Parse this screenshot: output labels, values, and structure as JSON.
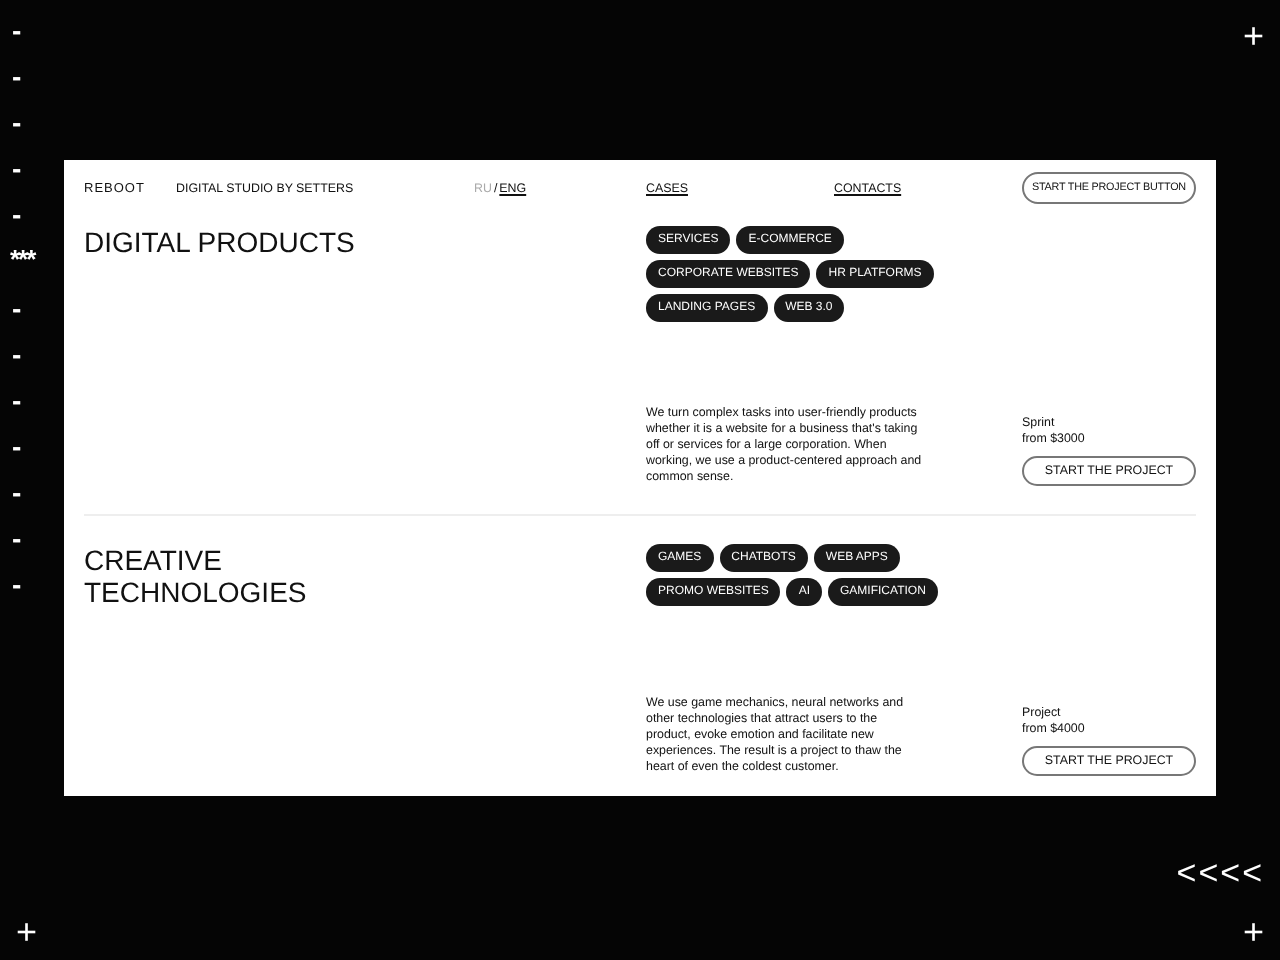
{
  "side_marks": [
    "-",
    "-",
    "-",
    "-",
    "-",
    "***",
    "-",
    "-",
    "-",
    "-",
    "-",
    "-",
    "-"
  ],
  "corner_marks": {
    "top_right": "+",
    "bottom_left": "+",
    "bottom_right": "+",
    "back_arrows": "<<<<"
  },
  "header": {
    "logo": "REBOOT",
    "tagline": "DIGITAL STUDIO BY SETTERS",
    "languages": [
      {
        "label": "RU",
        "selected": false
      },
      {
        "label": "ENG",
        "selected": true
      }
    ],
    "language_separator": "/",
    "nav": [
      "CASES",
      "CONTACTS"
    ],
    "cta": "START THE PROJECT BUTTON"
  },
  "sections": [
    {
      "title": "DIGITAL PRODUCTS",
      "tags": [
        "SERVICES",
        "E-COMMERCE",
        "CORPORATE WEBSITES",
        "HR PLATFORMS",
        "LANDING PAGES",
        "WEB 3.0"
      ],
      "description": "We turn complex tasks into user-friendly products whether it is a website for a business that's taking off or services for a large corporation. When working, we use a product-centered approach and common sense.",
      "plan": "Sprint",
      "price": "from $3000",
      "button": "START THE PROJECT"
    },
    {
      "title": "CREATIVE TECHNOLOGIES",
      "tags": [
        "GAMES",
        "CHATBOTS",
        "WEB APPS",
        "PROMO WEBSITES",
        "AI",
        "GAMIFICATION"
      ],
      "description": "We use game mechanics, neural networks and other technologies that attract users to the product, evoke emotion and facilitate new experiences. The result is a project to thaw the heart of even the coldest customer.",
      "plan": "Project",
      "price": "from $4000",
      "button": "START THE PROJECT"
    }
  ]
}
